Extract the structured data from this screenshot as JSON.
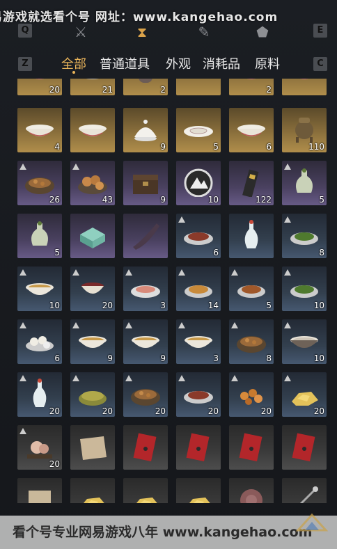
{
  "watermark_top": "易游戏就选看个号  网址：www.kangehao.com",
  "toolbar": {
    "left_key": "Q",
    "right_key": "E",
    "icons": [
      "crossed-swords-icon",
      "hourglass-icon",
      "scroll-icon",
      "map-pin-icon"
    ]
  },
  "tabs": {
    "left_key": "Z",
    "right_key": "C",
    "items": [
      "全部",
      "普通道具",
      "外观",
      "消耗品",
      "原料"
    ],
    "active": "全部"
  },
  "rows": [
    [
      {
        "q": "gold",
        "c": "20",
        "art": "bowl"
      },
      {
        "q": "gold",
        "c": "21",
        "art": "dish"
      },
      {
        "q": "gold",
        "c": "2",
        "art": "jar"
      },
      {
        "q": "gold",
        "c": "",
        "art": "herb"
      },
      {
        "q": "gold",
        "c": "2",
        "art": "bowl"
      },
      {
        "q": "gold",
        "c": "",
        "art": "bowl"
      }
    ],
    [
      {
        "q": "gold",
        "c": "4",
        "art": "bowl"
      },
      {
        "q": "gold",
        "c": "",
        "art": "bowl"
      },
      {
        "q": "gold",
        "c": "9",
        "art": "lidbowl"
      },
      {
        "q": "gold",
        "c": "5",
        "art": "plate"
      },
      {
        "q": "gold",
        "c": "6",
        "art": "bowl"
      },
      {
        "q": "gold",
        "c": "110",
        "art": "censer"
      }
    ],
    [
      {
        "q": "purple",
        "c": "26",
        "art": "stew",
        "b": true
      },
      {
        "q": "purple",
        "c": "43",
        "art": "buns",
        "b": true
      },
      {
        "q": "purple",
        "c": "9",
        "art": "chest"
      },
      {
        "q": "purple",
        "c": "10",
        "art": "emblem"
      },
      {
        "q": "purple",
        "c": "122",
        "art": "talisman"
      },
      {
        "q": "purple",
        "c": "5",
        "art": "vase",
        "b": true
      }
    ],
    [
      {
        "q": "purple",
        "c": "5",
        "art": "vase"
      },
      {
        "q": "purple",
        "c": "",
        "art": "box"
      },
      {
        "q": "purple",
        "c": "",
        "art": "horn"
      },
      {
        "q": "blue",
        "c": "6",
        "art": "meat",
        "b": true
      },
      {
        "q": "blue",
        "c": "",
        "art": "whitevase"
      },
      {
        "q": "blue",
        "c": "8",
        "art": "greens",
        "b": true
      }
    ],
    [
      {
        "q": "blue",
        "c": "10",
        "art": "soup",
        "b": true
      },
      {
        "q": "blue",
        "c": "20",
        "art": "cup",
        "b": true
      },
      {
        "q": "blue",
        "c": "3",
        "art": "fish",
        "b": true
      },
      {
        "q": "blue",
        "c": "14",
        "art": "noodles",
        "b": true
      },
      {
        "q": "blue",
        "c": "5",
        "art": "stirfry",
        "b": true
      },
      {
        "q": "blue",
        "c": "10",
        "art": "greens",
        "b": true
      }
    ],
    [
      {
        "q": "blue",
        "c": "6",
        "art": "dumplings",
        "b": true
      },
      {
        "q": "blue",
        "c": "9",
        "art": "soup",
        "b": true
      },
      {
        "q": "blue",
        "c": "9",
        "art": "soup",
        "b": true
      },
      {
        "q": "blue",
        "c": "3",
        "art": "soup",
        "b": true
      },
      {
        "q": "blue",
        "c": "8",
        "art": "stew",
        "b": true
      },
      {
        "q": "blue",
        "c": "10",
        "art": "congee",
        "b": true
      }
    ],
    [
      {
        "q": "blue",
        "c": "20",
        "art": "whitevase",
        "b": true
      },
      {
        "q": "blue",
        "c": "20",
        "art": "grains",
        "b": true
      },
      {
        "q": "blue",
        "c": "20",
        "art": "stew",
        "b": true
      },
      {
        "q": "blue",
        "c": "20",
        "art": "meat",
        "b": true
      },
      {
        "q": "blue",
        "c": "20",
        "art": "nuts",
        "b": true
      },
      {
        "q": "blue",
        "c": "20",
        "art": "gold",
        "b": true
      }
    ],
    [
      {
        "q": "gray",
        "c": "20",
        "art": "knot",
        "b": true
      },
      {
        "q": "gray",
        "c": "",
        "art": "cloth"
      },
      {
        "q": "gray",
        "c": "",
        "art": "envelope"
      },
      {
        "q": "gray",
        "c": "",
        "art": "envelope"
      },
      {
        "q": "gray",
        "c": "",
        "art": "envelope"
      },
      {
        "q": "gray",
        "c": "",
        "art": "envelope"
      }
    ],
    [
      {
        "q": "gray",
        "c": "",
        "art": "scroll"
      },
      {
        "q": "gray",
        "c": "",
        "art": "gold"
      },
      {
        "q": "gray",
        "c": "",
        "art": "gold"
      },
      {
        "q": "gray",
        "c": "",
        "art": "gold"
      },
      {
        "q": "gray",
        "c": "",
        "art": "disc"
      },
      {
        "q": "gray",
        "c": "",
        "art": "stick"
      }
    ]
  ],
  "bottom_banner": "看个号专业网易游戏八年  www.kangehao.com",
  "colors": {
    "accent": "#e9b45a",
    "gold_slot": "#8a6f3c",
    "purple_slot": "#4a4160",
    "blue_slot": "#33404f"
  }
}
